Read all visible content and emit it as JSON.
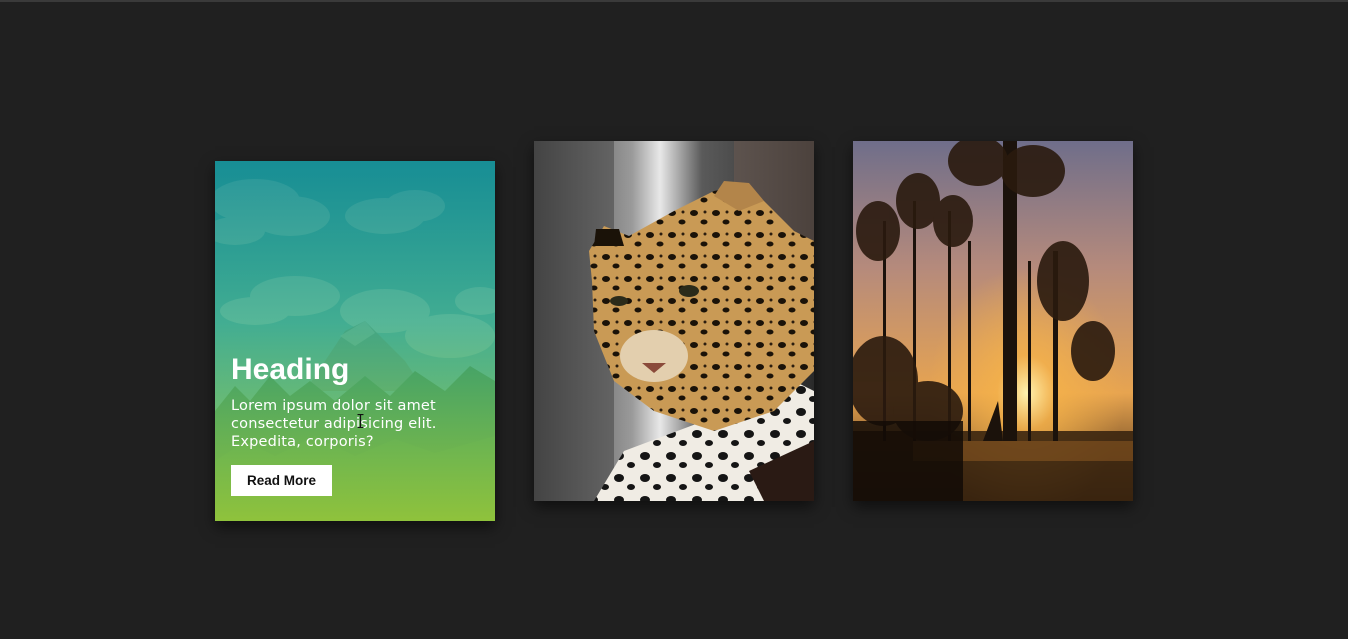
{
  "cards": [
    {
      "heading": "Heading",
      "text": "Lorem ipsum dolor sit amet consectetur adipisicing elit. Expedita, corporis?",
      "button_label": "Read More",
      "image": "mountain-landscape-image",
      "overlay_colors": [
        "#108a8e",
        "#96c83c"
      ]
    },
    {
      "image": "leopard-image"
    },
    {
      "image": "swamp-sunset-image"
    }
  ],
  "colors": {
    "page_background": "#202020",
    "button_background": "#ffffff",
    "button_text": "#111111",
    "heading_text": "#ffffff"
  }
}
